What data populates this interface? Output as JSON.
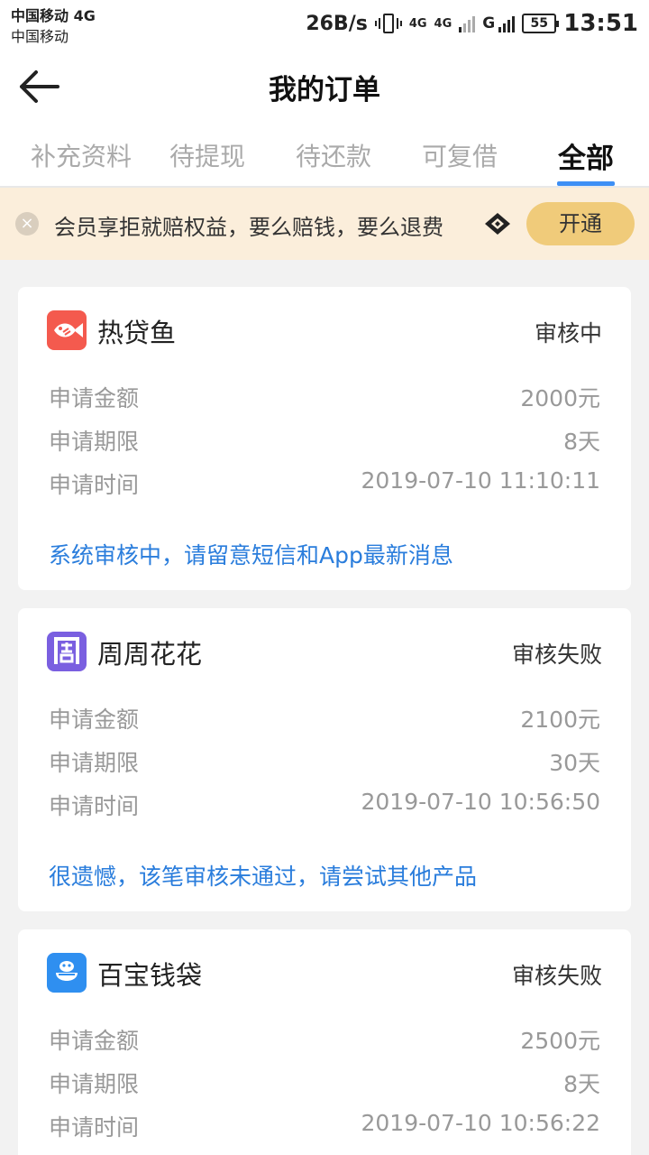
{
  "status_bar": {
    "carrier_1": "中国移动 4G",
    "carrier_2": "中国移动",
    "net_speed": "26B/s",
    "net_tag_1": "4G",
    "net_tag_2": "4G",
    "g_label": "G",
    "battery": "55",
    "time": "13:51"
  },
  "header": {
    "title": "我的订单"
  },
  "tabs": [
    {
      "label": "补充资料",
      "active": false
    },
    {
      "label": "待提现",
      "active": false
    },
    {
      "label": "待还款",
      "active": false
    },
    {
      "label": "可复借",
      "active": false
    },
    {
      "label": "全部",
      "active": true
    }
  ],
  "banner": {
    "text": "会员享拒就赔权益，要么赔钱，要么退费",
    "button_label": "开通"
  },
  "colors": {
    "accent_blue": "#2a7ddc",
    "tab_indicator": "#3d8ff5",
    "banner_bg": "#fbeedb",
    "button_gold": "#f0cb7a"
  },
  "orders": [
    {
      "name": "热贷鱼",
      "logo_icon": "fish-logo-icon",
      "logo_color": "#f45a4e",
      "status": "审核中",
      "amount_label": "申请金额",
      "amount": "2000元",
      "term_label": "申请期限",
      "term": "8天",
      "time_label": "申请时间",
      "time": "2019-07-10 11:10:11",
      "note": "系统审核中，请留意短信和App最新消息"
    },
    {
      "name": "周周花花",
      "logo_icon": "zhou-logo-icon",
      "logo_color": "#7a5fe0",
      "status": "审核失败",
      "amount_label": "申请金额",
      "amount": "2100元",
      "term_label": "申请期限",
      "term": "30天",
      "time_label": "申请时间",
      "time": "2019-07-10 10:56:50",
      "note": "很遗憾，该笔审核未通过，请尝试其他产品"
    },
    {
      "name": "百宝钱袋",
      "logo_icon": "bag-logo-icon",
      "logo_color": "#2f8ff0",
      "status": "审核失败",
      "amount_label": "申请金额",
      "amount": "2500元",
      "term_label": "申请期限",
      "term": "8天",
      "time_label": "申请时间",
      "time": "2019-07-10 10:56:22"
    }
  ]
}
